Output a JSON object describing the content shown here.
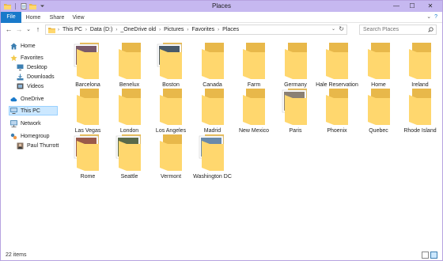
{
  "window": {
    "title": "Places"
  },
  "quick_access": [
    {
      "icon": "properties-icon"
    },
    {
      "icon": "new-folder-icon"
    },
    {
      "icon": "customize-dropdown-icon"
    }
  ],
  "window_buttons": {
    "minimize": "—",
    "maximize": "☐",
    "close": "✕"
  },
  "ribbon": {
    "tabs": [
      "File",
      "Home",
      "Share",
      "View"
    ],
    "collapse_glyph": "⌄",
    "help_glyph": "?"
  },
  "nav_buttons": {
    "back": "←",
    "forward": "→",
    "recent": "⌄",
    "up": "↑"
  },
  "address": {
    "crumbs": [
      "This PC",
      "Data (D:)",
      "_OneDrive old",
      "Pictures",
      "Favorites",
      "Places"
    ],
    "separator": "›",
    "dropdown": "⌄",
    "refresh": "↻"
  },
  "search": {
    "placeholder": "Search Places"
  },
  "nav_pane": [
    {
      "label": "Home",
      "icon": "home-icon",
      "level": 0
    },
    {
      "label": "Favorites",
      "icon": "star-icon",
      "level": 0
    },
    {
      "label": "Desktop",
      "icon": "desktop-icon",
      "level": 1
    },
    {
      "label": "Downloads",
      "icon": "downloads-icon",
      "level": 1
    },
    {
      "label": "Videos",
      "icon": "videos-icon",
      "level": 1
    },
    {
      "label": "OneDrive",
      "icon": "cloud-icon",
      "level": 0
    },
    {
      "label": "This PC",
      "icon": "computer-icon",
      "level": 0,
      "selected": true
    },
    {
      "label": "Network",
      "icon": "network-icon",
      "level": 0
    },
    {
      "label": "Homegroup",
      "icon": "homegroup-icon",
      "level": 0
    },
    {
      "label": "Paul Thurrott",
      "icon": "user-icon",
      "level": 1
    }
  ],
  "folders": [
    {
      "name": "Barcelona",
      "thumb": "#7a5a6a"
    },
    {
      "name": "Benelux"
    },
    {
      "name": "Boston",
      "thumb": "#4a5a6a"
    },
    {
      "name": "Canada"
    },
    {
      "name": "Farm"
    },
    {
      "name": "Germany"
    },
    {
      "name": "Hale Reservation"
    },
    {
      "name": "Home"
    },
    {
      "name": "Ireland"
    },
    {
      "name": "Las Vegas"
    },
    {
      "name": "London"
    },
    {
      "name": "Los Angeles"
    },
    {
      "name": "Madrid"
    },
    {
      "name": "New Mexico"
    },
    {
      "name": "Paris",
      "thumb": "#8a8074"
    },
    {
      "name": "Phoenix"
    },
    {
      "name": "Quebec"
    },
    {
      "name": "Rhode Island"
    },
    {
      "name": "Rome",
      "thumb": "#9a5a4a"
    },
    {
      "name": "Seattle",
      "thumb": "#5a6a4a"
    },
    {
      "name": "Vermont"
    },
    {
      "name": "Washington DC",
      "thumb": "#6a8aaa"
    }
  ],
  "status": {
    "item_count": "22 items"
  },
  "colors": {
    "title_bar": "#c6b8f0",
    "file_tab": "#1979ca",
    "folder_back": "#e8b84a",
    "folder_front": "#ffd76e",
    "selection": "#cce8ff"
  }
}
